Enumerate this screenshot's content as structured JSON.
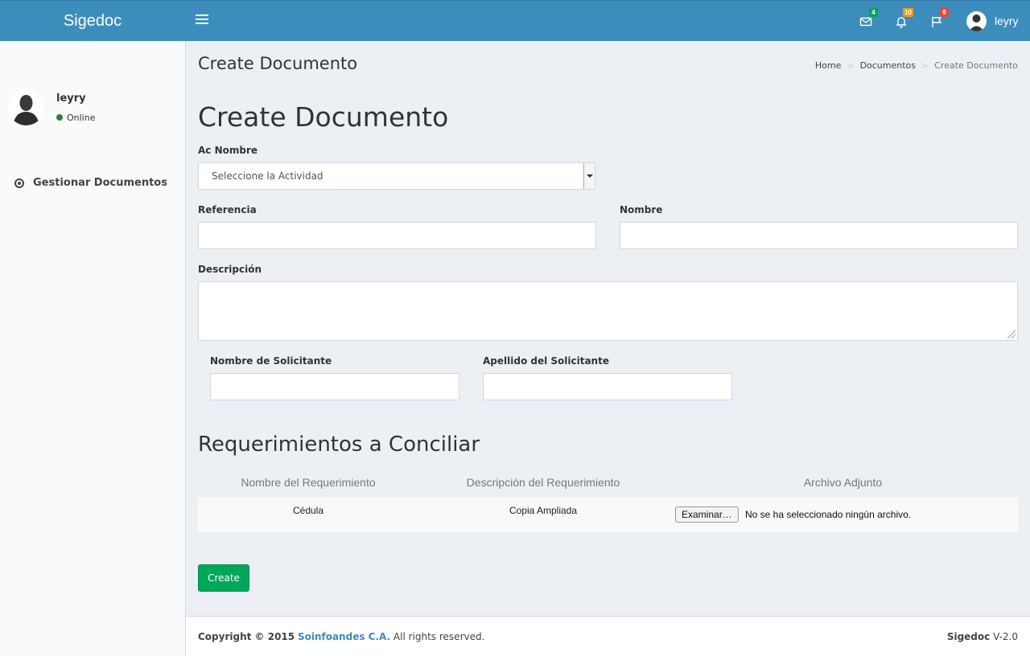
{
  "app": {
    "name": "Sigedoc"
  },
  "header": {
    "notifications": [
      {
        "icon": "envelope-icon",
        "count": "4",
        "color": "#00a65a"
      },
      {
        "icon": "bell-icon",
        "count": "10",
        "color": "#f39c12"
      },
      {
        "icon": "flag-icon",
        "count": "9",
        "color": "#dd4b39"
      }
    ],
    "user_name": "leyry"
  },
  "sidebar": {
    "user_name": "leyry",
    "status": "Online",
    "items": [
      {
        "label": "Gestionar Documentos",
        "icon": "circle-dot-icon"
      }
    ]
  },
  "content_header": {
    "title": "Create Documento",
    "breadcrumb": [
      "Home",
      "Documentos",
      "Create Documento"
    ]
  },
  "form": {
    "heading": "Create Documento",
    "ac_nombre_label": "Ac Nombre",
    "ac_nombre_value": "Seleccione la Actividad",
    "referencia_label": "Referencia",
    "nombre_label": "Nombre",
    "descripcion_label": "Descripción",
    "nombre_solicitante_label": "Nombre de Solicitante",
    "apellido_solicitante_label": "Apellido del Solicitante",
    "submit_label": "Create"
  },
  "requerimientos": {
    "heading": "Requerimientos a Conciliar",
    "columns": [
      "Nombre del Requerimiento",
      "Descripción del Requerimiento",
      "Archivo Adjunto"
    ],
    "rows": [
      {
        "nombre": "Cédula",
        "descripcion": "Copia Ampliada",
        "file_button": "Examinar…",
        "file_status": "No se ha seleccionado ningún archivo."
      }
    ]
  },
  "footer": {
    "copyright_prefix": "Copyright © 2015",
    "company": "Soinfoandes C.A.",
    "rights": "All rights reserved.",
    "product": "Sigedoc",
    "version": "V-2.0"
  }
}
